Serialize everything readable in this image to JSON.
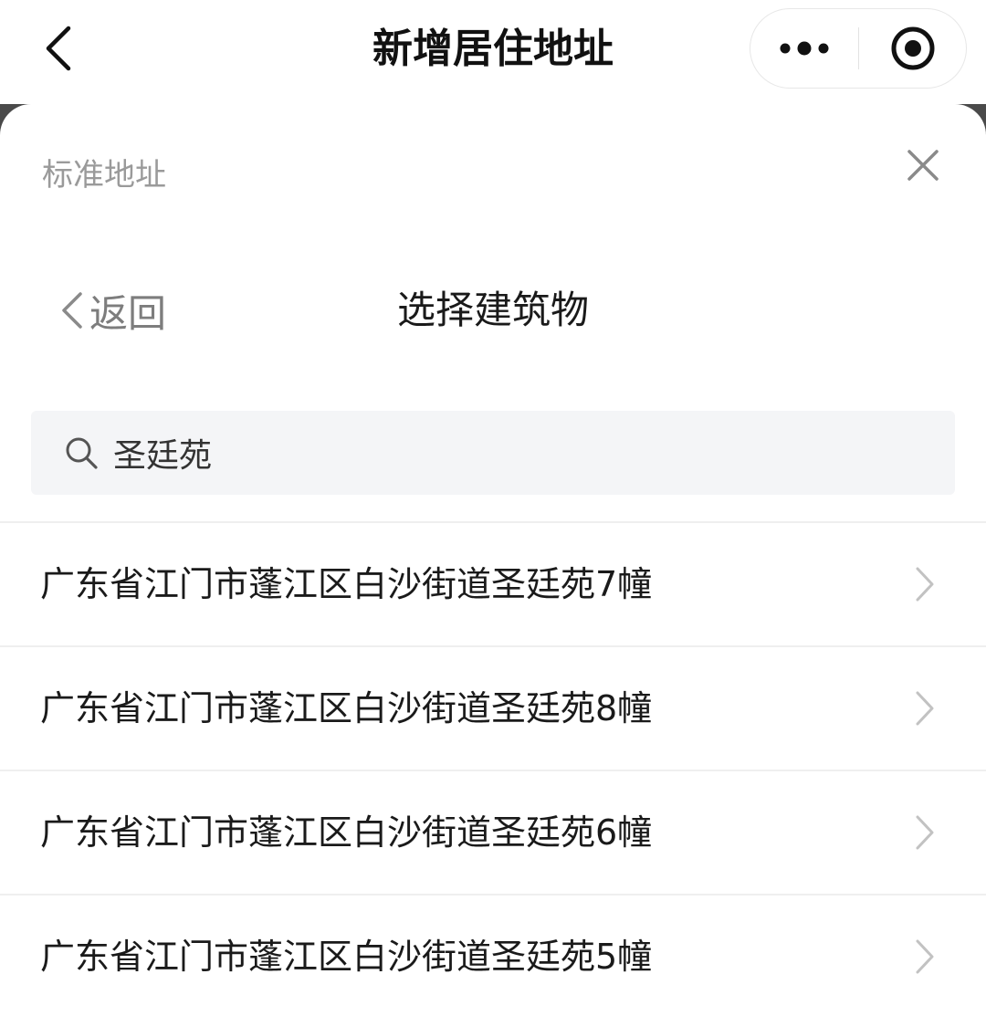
{
  "navbar": {
    "title": "新增居住地址",
    "back_icon": "chevron-left-icon",
    "more_icon": "more-dots-icon",
    "close_icon": "target-circle-icon"
  },
  "sheet": {
    "header": "标准地址",
    "close_icon": "close-x-icon",
    "back_label": "返回",
    "back_icon": "chevron-left-icon",
    "sub_title": "选择建筑物",
    "search": {
      "value": "圣廷苑",
      "icon": "search-icon"
    },
    "results": [
      {
        "label": "广东省江门市蓬江区白沙街道圣廷苑7幢"
      },
      {
        "label": "广东省江门市蓬江区白沙街道圣廷苑8幢"
      },
      {
        "label": "广东省江门市蓬江区白沙街道圣廷苑6幢"
      },
      {
        "label": "广东省江门市蓬江区白沙街道圣廷苑5幢"
      }
    ]
  },
  "colors": {
    "backdrop": "#4a4a4a",
    "search_background": "#f4f5f7",
    "muted_text": "#9a9a9a",
    "divider": "#efefef"
  }
}
